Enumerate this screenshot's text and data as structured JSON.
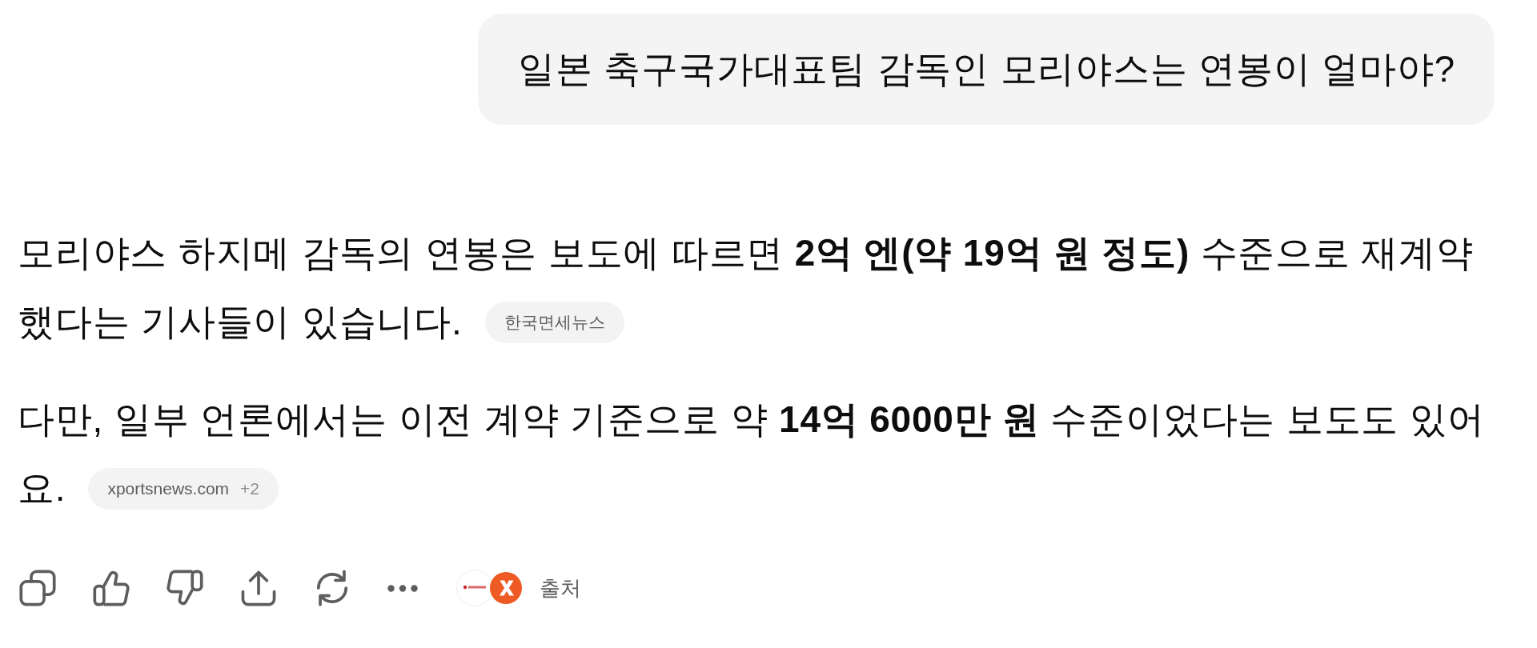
{
  "user_message": {
    "text": "일본 축구국가대표팀 감독인 모리야스는 연봉이 얼마야?"
  },
  "answer": {
    "paragraphs": [
      {
        "text": "모리야스 하지메 감독의 연봉은 보도에 따르면 **2억 엔(약 19억 원 정도)** 수준으로 재계약했다는 기사들이 있습니다.",
        "citation": {
          "source": "한국면세뉴스"
        }
      },
      {
        "text": "다만, 일부 언론에서는 이전 계약 기준으로 약 **14억 6000만 원** 수준이었다는 보도도 있어요.",
        "citation": {
          "source": "xportsnews.com",
          "extra": "+2"
        }
      }
    ]
  },
  "sources_button": {
    "label": "출처"
  }
}
